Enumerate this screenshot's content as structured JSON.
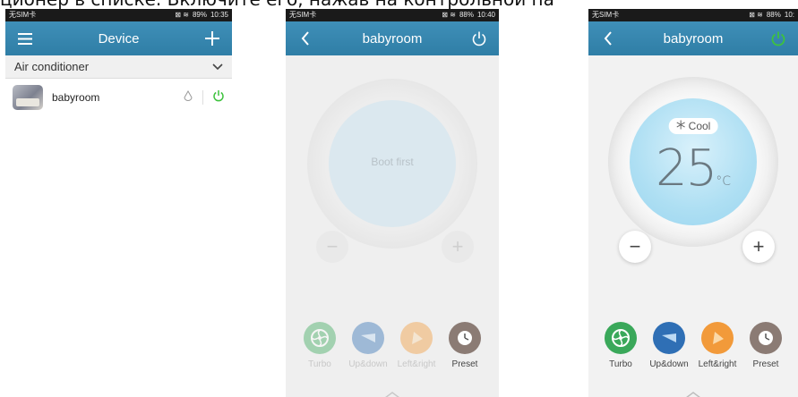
{
  "caption": "ционер в списке. Включите его, нажав на контрольной па",
  "screen_list": {
    "statusbar": {
      "carrier": "无SIM卡",
      "icons": "⊠ ≋",
      "battery": "89%",
      "time": "10:35"
    },
    "title": "Device",
    "category": "Air conditioner",
    "device": {
      "name": "babyroom"
    }
  },
  "screen_off": {
    "statusbar": {
      "carrier": "无SIM卡",
      "icons": "⊠ ≋",
      "battery": "88%",
      "time": "10:40"
    },
    "title": "babyroom",
    "status_text": "Boot first",
    "minus": "−",
    "plus": "+",
    "functions": [
      {
        "label": "Turbo"
      },
      {
        "label": "Up&down"
      },
      {
        "label": "Left&right"
      },
      {
        "label": "Preset"
      }
    ]
  },
  "screen_on": {
    "statusbar": {
      "carrier": "无SIM卡",
      "icons": "⊠ ≋",
      "battery": "88%",
      "time": "10:"
    },
    "title": "babyroom",
    "mode": "Cool",
    "temperature": "25",
    "unit": "°C",
    "minus": "−",
    "plus": "+",
    "functions": [
      {
        "label": "Turbo"
      },
      {
        "label": "Up&down"
      },
      {
        "label": "Left&right"
      },
      {
        "label": "Preset"
      }
    ]
  },
  "colors": {
    "header": "#3a8ab3",
    "power_green": "#3ec23e",
    "turbo": "#3aa85a",
    "updown": "#2f6fb5",
    "leftright": "#f29a3a",
    "preset": "#8b7b74"
  }
}
